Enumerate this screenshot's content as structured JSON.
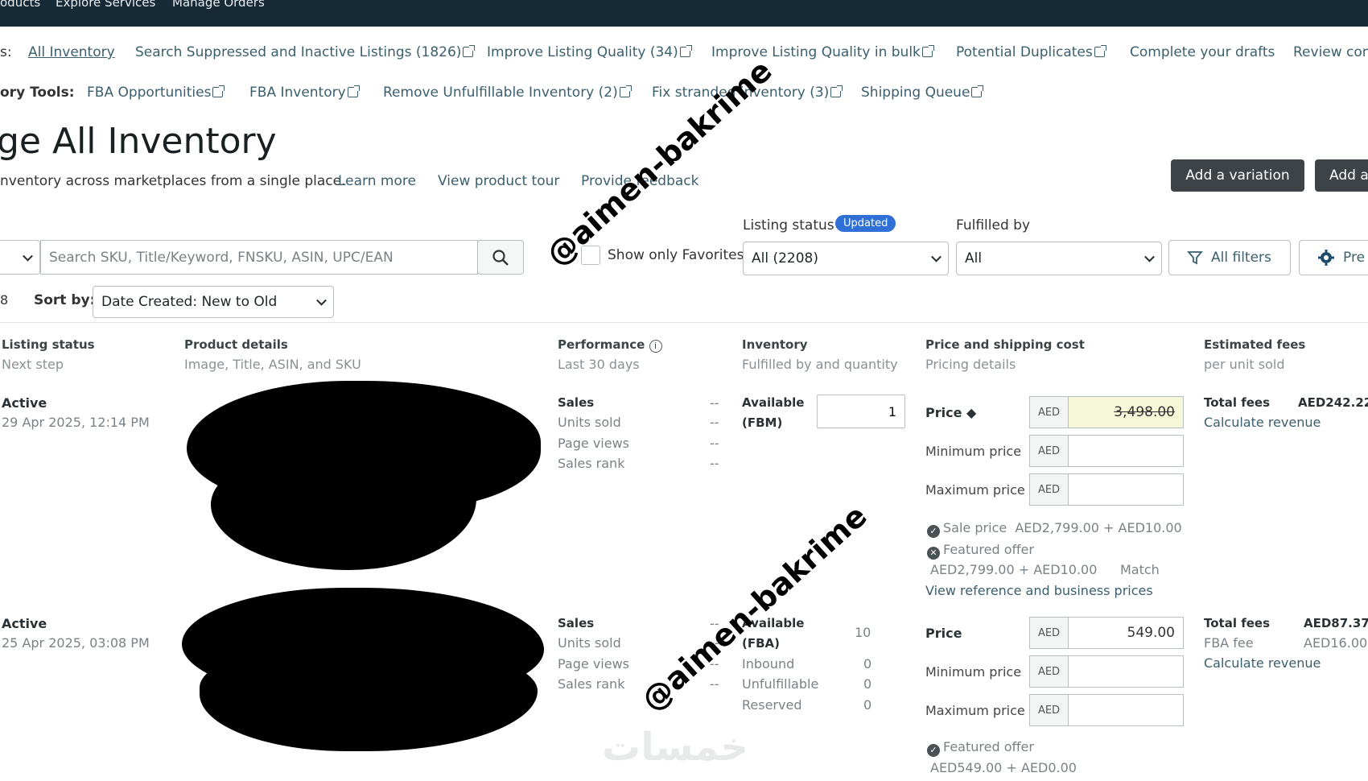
{
  "topnav": {
    "items": [
      "oducts",
      "Explore Services",
      "Manage Orders"
    ]
  },
  "views_row": {
    "label": "s:",
    "items": [
      "All Inventory",
      "Search Suppressed and Inactive Listings (1826)",
      "Improve Listing Quality (34)",
      "Improve Listing Quality in bulk",
      "Potential Duplicates",
      "Complete your drafts",
      "Review com"
    ]
  },
  "tools_row": {
    "label": "ory Tools:",
    "items": [
      "FBA Opportunities",
      "FBA Inventory",
      "Remove Unfulfillable Inventory (2)",
      "Fix stranded inventory (3)",
      "Shipping Queue"
    ]
  },
  "page": {
    "title": "ge All Inventory",
    "subtitle": "nventory across marketplaces from a single place.",
    "learn_more": "Learn more",
    "product_tour": "View product tour",
    "feedback": "Provide feedback",
    "add_variation": "Add a variation",
    "add_other": "Add a"
  },
  "filters": {
    "search_placeholder": "Search SKU, Title/Keyword, FNSKU, ASIN, UPC/EAN",
    "favorites_label": "Show only Favorites",
    "listing_status_label": "Listing status",
    "updated_badge": "Updated",
    "listing_status_value": "All (2208)",
    "fulfilled_by_label": "Fulfilled by",
    "fulfilled_by_value": "All",
    "all_filters": "All filters",
    "prefs": "Pre",
    "count_fragment": "8",
    "sort_label": "Sort by:",
    "sort_value": "Date Created: New to Old"
  },
  "columns": [
    {
      "title": "Listing status",
      "sub": "Next step"
    },
    {
      "title": "Product details",
      "sub": "Image, Title, ASIN, and SKU"
    },
    {
      "title": "Performance",
      "sub": "Last 30 days"
    },
    {
      "title": "Inventory",
      "sub": "Fulfilled by and quantity"
    },
    {
      "title": "Price and shipping cost",
      "sub": "Pricing details"
    },
    {
      "title": "Estimated fees",
      "sub": "per unit sold"
    }
  ],
  "rows": [
    {
      "status": "Active",
      "date": "29 Apr 2025, 12:14 PM",
      "perf": {
        "sales": "Sales",
        "units": "Units sold",
        "views": "Page views",
        "rank": "Sales rank",
        "dash": "--"
      },
      "inv_label": "Available",
      "inv_type": "(FBM)",
      "inv_qty": "1",
      "price_label": "Price",
      "currency": "AED",
      "price_value": "3,498.00",
      "min_label": "Minimum price",
      "max_label": "Maximum price",
      "sale_price_label": "Sale price",
      "sale_price_value": "AED2,799.00 + AED10.00",
      "featured_label": "Featured offer",
      "featured_value": "AED2,799.00 + AED10.00",
      "match": "Match",
      "view_ref": "View reference and business prices",
      "fees_label": "Total fees",
      "fees_value": "AED242.22",
      "calc": "Calculate revenue"
    },
    {
      "status": "Active",
      "date": "25 Apr 2025, 03:08 PM",
      "perf": {
        "sales": "Sales",
        "units": "Units sold",
        "views": "Page views",
        "rank": "Sales rank",
        "dash": "--"
      },
      "inv_label": "Available",
      "inv_type": "(FBA)",
      "inv_qty": "10",
      "inbound": "Inbound",
      "inbound_v": "0",
      "unfulfillable": "Unfulfillable",
      "unfulfillable_v": "0",
      "reserved": "Reserved",
      "reserved_v": "0",
      "price_label": "Price",
      "currency": "AED",
      "price_value": "549.00",
      "min_label": "Minimum price",
      "max_label": "Maximum price",
      "featured_label": "Featured offer",
      "featured_value": "AED549.00 + AED0.00",
      "fees_label": "Total fees",
      "fees_value": "AED87.37",
      "fba_fee_label": "FBA fee",
      "fba_fee_value": "AED16.00",
      "calc": "Calculate revenue"
    }
  ],
  "watermarks": {
    "handle": "@aimen-bakrime",
    "site": "خمسات"
  }
}
